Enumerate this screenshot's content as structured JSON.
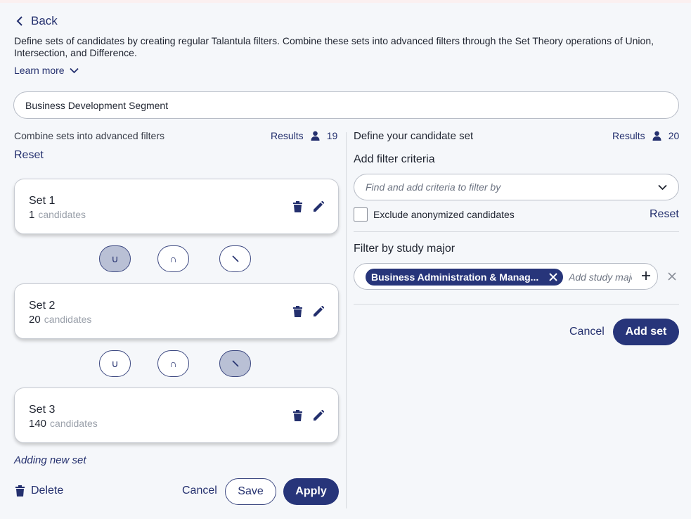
{
  "header": {
    "back_label": "Back",
    "description": "Define sets of candidates by creating regular Talantula filters. Combine these sets into advanced filters through the Set Theory operations of Union, Intersection, and Difference.",
    "learn_more_label": "Learn more"
  },
  "filter_name": {
    "value": "Business Development Segment"
  },
  "left": {
    "heading": "Combine sets into advanced filters",
    "results_label": "Results",
    "results_count": "19",
    "reset_label": "Reset",
    "sets": [
      {
        "title": "Set 1",
        "count": "1",
        "count_label": "candidates"
      },
      {
        "title": "Set 2",
        "count": "20",
        "count_label": "candidates"
      },
      {
        "title": "Set 3",
        "count": "140",
        "count_label": "candidates"
      }
    ],
    "operators": [
      {
        "union": "∪",
        "intersection": "∩",
        "active": "union"
      },
      {
        "union": "∪",
        "intersection": "∩",
        "active": "difference"
      }
    ],
    "adding_label": "Adding new set",
    "delete_label": "Delete",
    "cancel_label": "Cancel",
    "save_label": "Save",
    "apply_label": "Apply"
  },
  "right": {
    "heading": "Define your candidate set",
    "results_label": "Results",
    "results_count": "20",
    "add_filter_label": "Add filter criteria",
    "criteria_placeholder": "Find and add criteria to filter by",
    "exclude_label": "Exclude anonymized candidates",
    "exclude_checked": false,
    "reset_label": "Reset",
    "study_major_label": "Filter by study major",
    "major_chip": "Business Administration & Manag...",
    "major_placeholder": "Add study major",
    "cancel_label": "Cancel",
    "add_set_label": "Add set"
  },
  "colors": {
    "accent": "#27357a",
    "link": "#24306e",
    "active_operator": "#b9c0d5",
    "background": "#f5f7fa"
  }
}
